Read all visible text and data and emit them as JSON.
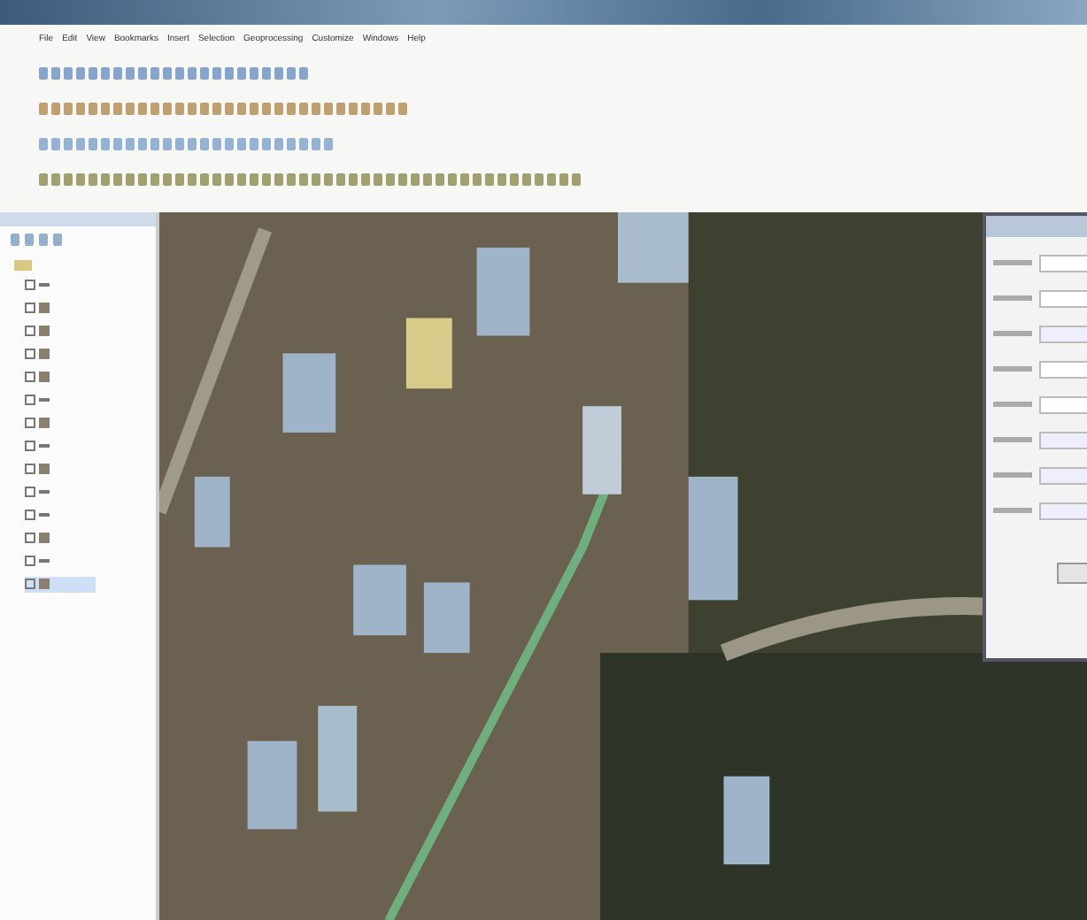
{
  "menu": [
    "File",
    "Edit",
    "View",
    "Bookmarks",
    "Insert",
    "Selection",
    "Geoprocessing",
    "Customize",
    "Windows",
    "Help"
  ],
  "toolbars": [
    {
      "kind": "standard"
    },
    {
      "kind": "editor"
    },
    {
      "kind": "tools"
    },
    {
      "kind": "draw"
    }
  ],
  "layers": [
    {
      "kind": "line",
      "selected": false
    },
    {
      "kind": "polygon",
      "selected": false
    },
    {
      "kind": "polygon",
      "selected": false
    },
    {
      "kind": "polygon",
      "selected": false
    },
    {
      "kind": "polygon",
      "selected": false
    },
    {
      "kind": "line",
      "selected": false
    },
    {
      "kind": "polygon",
      "selected": false
    },
    {
      "kind": "line",
      "selected": false
    },
    {
      "kind": "polygon",
      "selected": false
    },
    {
      "kind": "line",
      "selected": false
    },
    {
      "kind": "line",
      "selected": false
    },
    {
      "kind": "polygon",
      "selected": false
    },
    {
      "kind": "line",
      "selected": false
    },
    {
      "kind": "polygon",
      "selected": true
    }
  ],
  "dialog": {
    "fields": [
      {
        "kind": "text"
      },
      {
        "kind": "text"
      },
      {
        "kind": "combo"
      },
      {
        "kind": "text"
      },
      {
        "kind": "text"
      },
      {
        "kind": "combo"
      },
      {
        "kind": "combo"
      },
      {
        "kind": "combo"
      }
    ]
  }
}
